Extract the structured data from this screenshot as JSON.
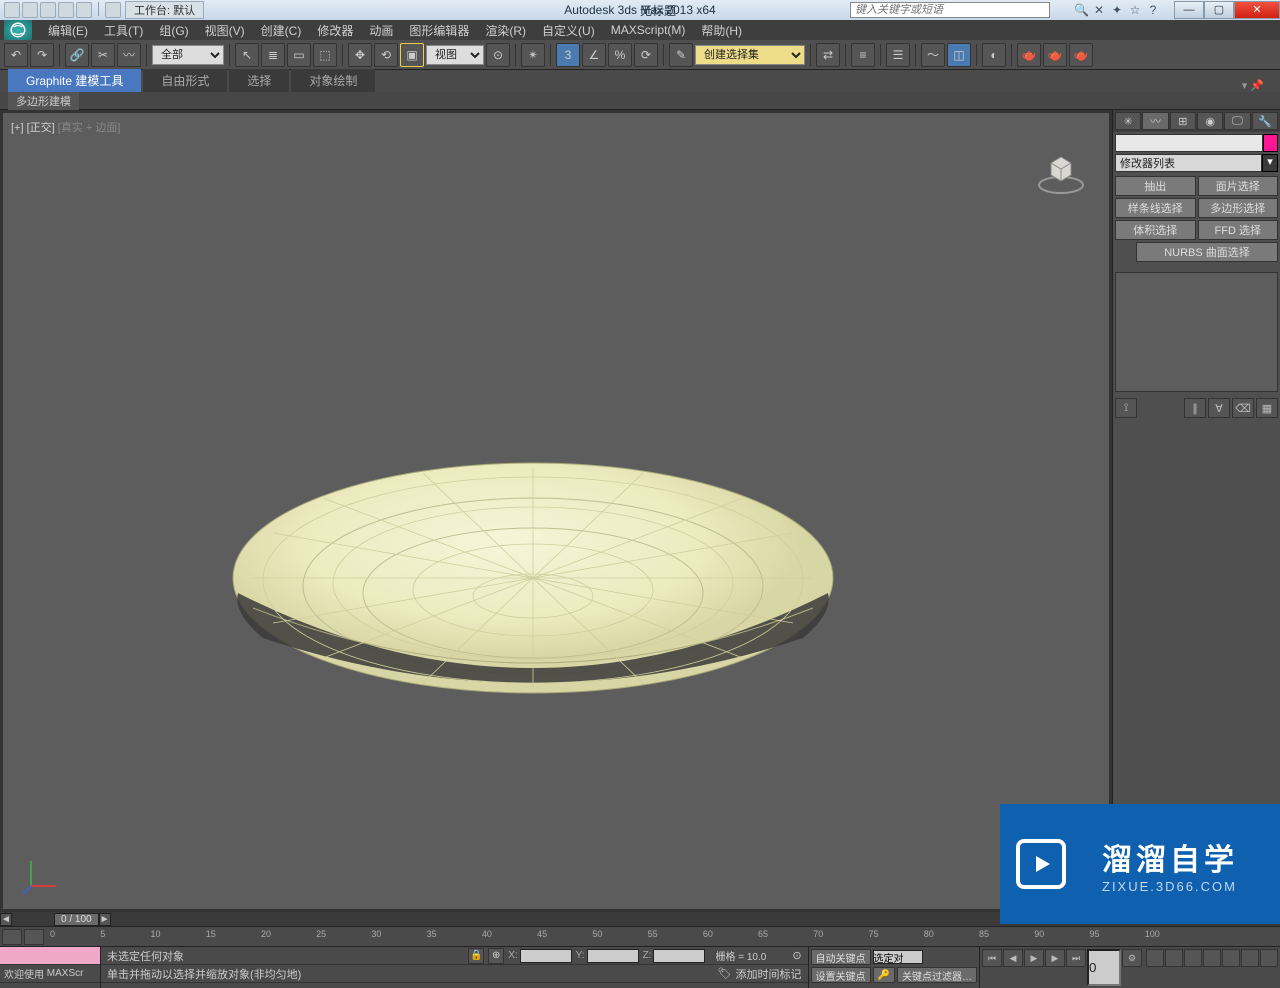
{
  "titlebar": {
    "workspace_label": "工作台: 默认",
    "app_title": "Autodesk 3ds Max  2013 x64",
    "doc_title": "无标题",
    "search_placeholder": "键入关键字或短语"
  },
  "menu": {
    "items": [
      "编辑(E)",
      "工具(T)",
      "组(G)",
      "视图(V)",
      "创建(C)",
      "修改器",
      "动画",
      "图形编辑器",
      "渲染(R)",
      "自定义(U)",
      "MAXScript(M)",
      "帮助(H)"
    ]
  },
  "toolbar": {
    "filter": "全部",
    "refsys": "视图",
    "named_sel": "创建选择集"
  },
  "ribbon": {
    "tabs": [
      "Graphite 建模工具",
      "自由形式",
      "选择",
      "对象绘制"
    ],
    "sub": "多边形建模"
  },
  "viewport": {
    "label_main": "[+] [正交]",
    "label_sub": "[真实 + 边面]"
  },
  "cmd": {
    "modifier_list": "修改器列表",
    "sets": [
      [
        "抽出",
        "面片选择"
      ],
      [
        "样条线选择",
        "多边形选择"
      ],
      [
        "体积选择",
        "FFD 选择"
      ]
    ],
    "nurbs": "NURBS 曲面选择"
  },
  "timeline": {
    "label": "0 / 100",
    "ticks": [
      "0",
      "5",
      "10",
      "15",
      "20",
      "25",
      "30",
      "35",
      "40",
      "45",
      "50",
      "55",
      "60",
      "65",
      "70",
      "75",
      "80",
      "85",
      "90",
      "95",
      "100"
    ]
  },
  "status": {
    "welcome": "欢迎使用",
    "maxscript": "MAXScr",
    "prompt1": "未选定任何对象",
    "prompt2": "单击并拖动以选择并缩放对象(非均匀地)",
    "xlabel": "X:",
    "ylabel": "Y:",
    "zlabel": "Z:",
    "grid": "栅格 = 10.0",
    "addtime": "添加时间标记",
    "autokey": "自动关键点",
    "setkey": "设置关键点",
    "selected": "选定对",
    "keyfilter": "关键点过滤器…",
    "frame": "0"
  },
  "watermark": {
    "title": "溜溜自学",
    "sub": "ZIXUE.3D66.COM"
  }
}
